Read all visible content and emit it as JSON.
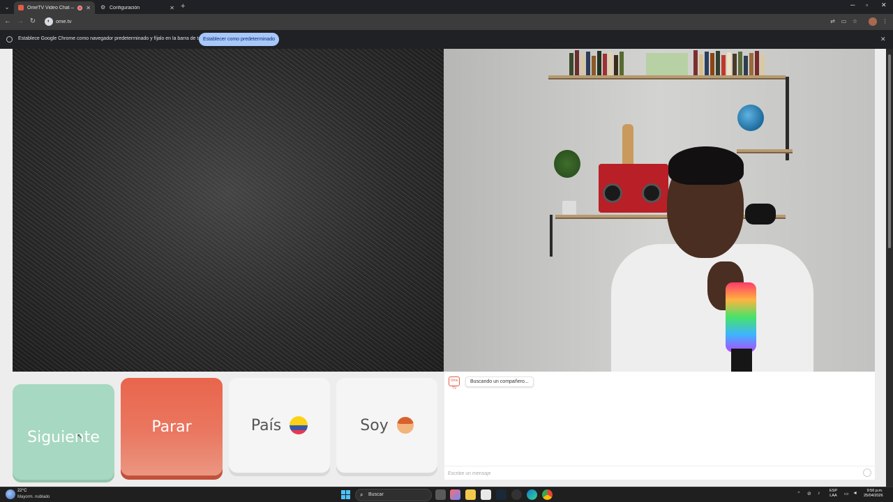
{
  "browser": {
    "tabs": [
      {
        "title": "OmeTV Video Chat — Ome",
        "active": true
      },
      {
        "title": "Configuración",
        "active": false
      }
    ],
    "url": "ome.tv",
    "infobar": {
      "message": "Establece Google Chrome como navegador predeterminado y fíjalo en la barra de tareas",
      "button": "Establecer como predeterminado"
    }
  },
  "controls": {
    "next_label": "Siguiente",
    "stop_label": "Parar",
    "country_label": "País",
    "gender_label": "Soy"
  },
  "chat": {
    "logo_text": "Ome TV",
    "status_message": "Buscando un compañero...",
    "input_placeholder": "Escribe un mensaje"
  },
  "taskbar": {
    "weather_temp": "22°C",
    "weather_desc": "Mayorm. nublado",
    "search_label": "Buscar",
    "lang_top": "ESP",
    "lang_bottom": "LAA",
    "time": "9:56 p.m.",
    "date": "25/04/2026"
  },
  "colors": {
    "next_button": "#a7d8c2",
    "stop_button": "#e9654c",
    "accent_blue": "#a8c7fa"
  }
}
